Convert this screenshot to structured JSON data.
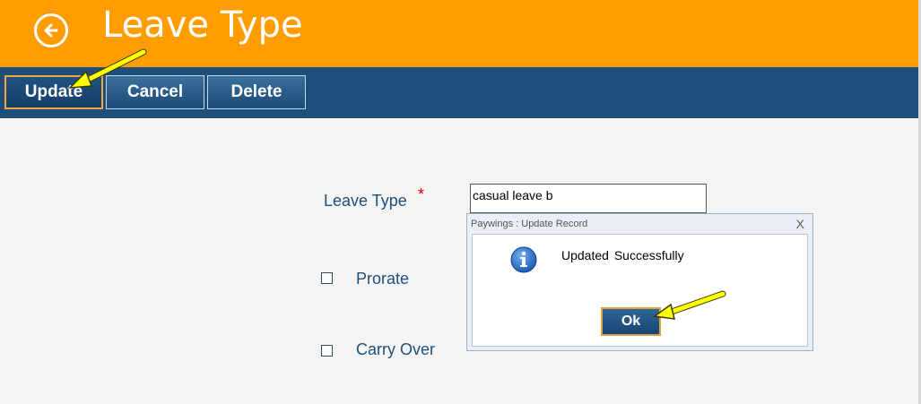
{
  "header": {
    "title": "Leave Type",
    "back_icon": "arrow-left-icon",
    "color": "#ff9c00"
  },
  "toolbar": {
    "update_label": "Update",
    "cancel_label": "Cancel",
    "delete_label": "Delete",
    "color": "#1d4f7a"
  },
  "form": {
    "leave_type_label": "Leave Type",
    "required_mark": "*",
    "leave_type_value": "casual leave b",
    "prorate_label": "Prorate",
    "carry_over_label": "Carry Over"
  },
  "dialog": {
    "title": "Paywings : Update Record",
    "close_label": "X",
    "message": "Updated Successfully",
    "ok_label": "Ok",
    "icon": "info-icon"
  },
  "annotations": {
    "arrow_color": "#ffff00"
  }
}
